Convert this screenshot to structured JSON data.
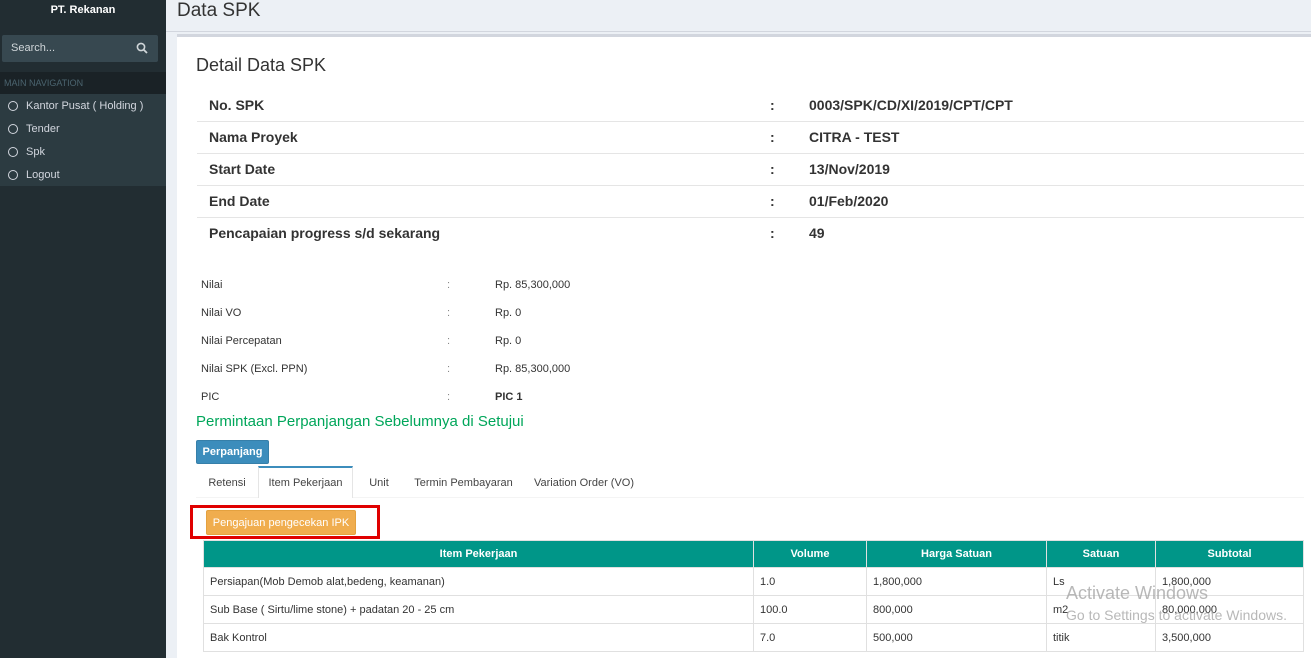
{
  "sidebar": {
    "brand": "PT. Rekanan",
    "search_placeholder": "Search...",
    "nav_header": "MAIN NAVIGATION",
    "items": [
      {
        "label": "Kantor Pusat ( Holding )"
      },
      {
        "label": "Tender"
      },
      {
        "label": "Spk"
      },
      {
        "label": "Logout"
      }
    ]
  },
  "header": {
    "title": "Data SPK"
  },
  "detail": {
    "title": "Detail Data SPK",
    "rows": [
      {
        "label": "No. SPK",
        "colon": ":",
        "value": "0003/SPK/CD/XI/2019/CPT/CPT"
      },
      {
        "label": "Nama Proyek",
        "colon": ":",
        "value": "CITRA - TEST"
      },
      {
        "label": "Start Date",
        "colon": ":",
        "value": "13/Nov/2019"
      },
      {
        "label": "End Date",
        "colon": ":",
        "value": "01/Feb/2020"
      },
      {
        "label": "Pencapaian progress s/d sekarang",
        "colon": ":",
        "value": "49"
      }
    ]
  },
  "values": {
    "rows": [
      {
        "label": "Nilai",
        "colon": ":",
        "value": "Rp. 85,300,000"
      },
      {
        "label": "Nilai VO",
        "colon": ":",
        "value": "Rp. 0"
      },
      {
        "label": "Nilai Percepatan",
        "colon": ":",
        "value": "Rp. 0"
      },
      {
        "label": "Nilai SPK (Excl. PPN)",
        "colon": ":",
        "value": "Rp. 85,300,000"
      },
      {
        "label": "PIC",
        "colon": ":",
        "value": "PIC 1"
      }
    ]
  },
  "note": "Permintaan Perpanjangan Sebelumnya di Setujui",
  "buttons": {
    "perpanjang": "Perpanjang",
    "ipk": "Pengajuan pengecekan IPK"
  },
  "tabs": [
    "Retensi",
    "Item Pekerjaan",
    "Unit",
    "Termin Pembayaran",
    "Variation Order (VO)"
  ],
  "active_tab": "Item Pekerjaan",
  "items_table": {
    "headers": [
      "Item Pekerjaan",
      "Volume",
      "Harga Satuan",
      "Satuan",
      "Subtotal"
    ],
    "rows": [
      [
        "Persiapan(Mob Demob alat,bedeng, keamanan)",
        "1.0",
        "1,800,000",
        "Ls",
        "1,800,000"
      ],
      [
        "Sub Base ( Sirtu/lime stone) + padatan 20 - 25 cm",
        "100.0",
        "800,000",
        "m2",
        "80,000,000"
      ],
      [
        "Bak Kontrol",
        "7.0",
        "500,000",
        "titik",
        "3,500,000"
      ]
    ]
  },
  "watermark": {
    "line1": "Activate Windows",
    "line2": "Go to Settings to activate Windows."
  },
  "colors": {
    "sidebar_bg": "#222d32",
    "primary": "#3c8dbc",
    "warning": "#f0ad4e",
    "table_header": "#009688",
    "success_text": "#00a65a",
    "highlight": "#e00000"
  }
}
